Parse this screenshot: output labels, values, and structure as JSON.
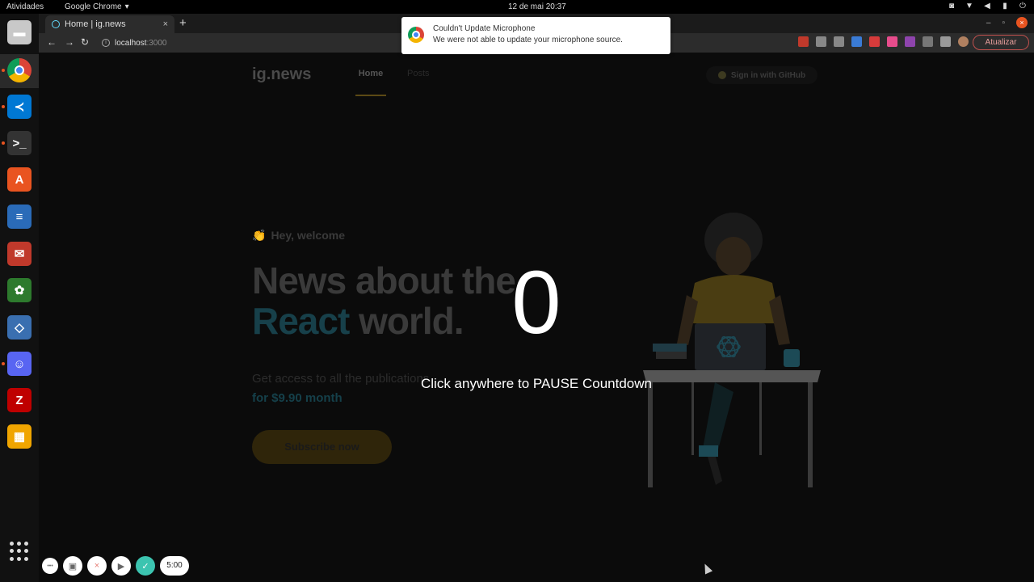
{
  "topbar": {
    "activities": "Atividades",
    "app_name": "Google Chrome",
    "app_caret": "▾",
    "clock": "12 de mai  20:37",
    "tray": [
      {
        "icon": "discord-icon",
        "glyph": "◙"
      },
      {
        "icon": "wifi-icon",
        "glyph": "▼"
      },
      {
        "icon": "volume-icon",
        "glyph": "◀"
      },
      {
        "icon": "battery-icon",
        "glyph": "▮"
      },
      {
        "icon": "power-icon",
        "glyph": "⏻"
      }
    ]
  },
  "dock": {
    "items": [
      {
        "name": "files",
        "icon": "files-icon",
        "glyph": "▬",
        "color": "#c8c8c8",
        "running": false
      },
      {
        "name": "chrome",
        "icon": "chrome-icon",
        "glyph": "",
        "color": "#4285f4",
        "running": true
      },
      {
        "name": "vscode",
        "icon": "vscode-icon",
        "glyph": "≺",
        "color": "#0078d4",
        "running": true
      },
      {
        "name": "terminal",
        "icon": "terminal-icon",
        "glyph": ">_",
        "color": "#333333",
        "running": true
      },
      {
        "name": "software",
        "icon": "software-store-icon",
        "glyph": "A",
        "color": "#e95420",
        "running": false
      },
      {
        "name": "writer",
        "icon": "document-icon",
        "glyph": "≡",
        "color": "#2a6bb8",
        "running": false
      },
      {
        "name": "postman",
        "icon": "postman-icon",
        "glyph": "✉",
        "color": "#c0392b",
        "running": false
      },
      {
        "name": "solitaire",
        "icon": "cards-icon",
        "glyph": "✿",
        "color": "#2d7a2d",
        "running": false
      },
      {
        "name": "network",
        "icon": "network-icon",
        "glyph": "◇",
        "color": "#3a6fb0",
        "running": false
      },
      {
        "name": "discord",
        "icon": "discord-icon",
        "glyph": "☺",
        "color": "#5865f2",
        "running": true
      },
      {
        "name": "filezilla",
        "icon": "filezilla-icon",
        "glyph": "Z",
        "color": "#bf0000",
        "running": false
      },
      {
        "name": "calculator",
        "icon": "calculator-icon",
        "glyph": "▦",
        "color": "#f0a500",
        "running": false
      }
    ]
  },
  "browser": {
    "tab_title": "Home | ig.news",
    "tab_close": "×",
    "new_tab": "+",
    "url_host": "localhost",
    "url_port": ":3000",
    "back": "←",
    "forward": "→",
    "reload": "↻",
    "update_button": "Atualizar",
    "win_min": "–",
    "win_max": "▫",
    "win_close": "×"
  },
  "notification": {
    "title": "Couldn't Update Microphone",
    "body": "We were not able to update your microphone source."
  },
  "site": {
    "logo": "ig.news",
    "nav_home": "Home",
    "nav_posts": "Posts",
    "signin": "Sign in with GitHub",
    "welcome": "Hey, welcome",
    "welcome_emoji": "👏",
    "headline_line1": "News about the",
    "headline_react": "React",
    "headline_rest": " world.",
    "subtitle": "Get access to all the publications",
    "price": "for $9.90 month",
    "subscribe": "Subscribe now"
  },
  "countdown": {
    "digit": "0",
    "hint": "Click anywhere to PAUSE Countdown"
  },
  "recorder": {
    "more": "•••",
    "close": "×",
    "ok": "✓",
    "time": "5:00"
  }
}
